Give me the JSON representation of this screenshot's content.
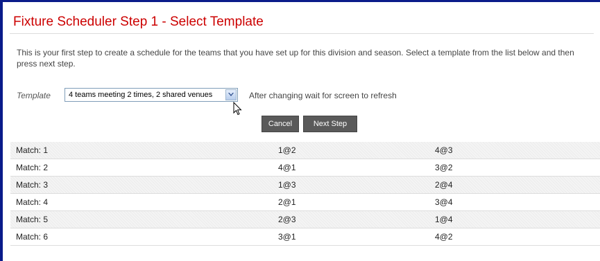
{
  "page": {
    "title": "Fixture Scheduler Step 1 - Select Template",
    "intro": "This is your first step to create a schedule for the teams that you have set up for this division and season. Select a template from the list below and then press next step."
  },
  "template": {
    "label": "Template",
    "selected": "4 teams meeting 2 times, 2 shared venues",
    "note": "After changing wait for screen to refresh"
  },
  "buttons": {
    "cancel": "Cancel",
    "next": "Next Step"
  },
  "matches": [
    {
      "label": "Match: 1",
      "a": "1@2",
      "b": "4@3"
    },
    {
      "label": "Match: 2",
      "a": "4@1",
      "b": "3@2"
    },
    {
      "label": "Match: 3",
      "a": "1@3",
      "b": "2@4"
    },
    {
      "label": "Match: 4",
      "a": "2@1",
      "b": "3@4"
    },
    {
      "label": "Match: 5",
      "a": "2@3",
      "b": "1@4"
    },
    {
      "label": "Match: 6",
      "a": "3@1",
      "b": "4@2"
    }
  ],
  "colors": {
    "title": "#cc0000",
    "frame": "#0a1b8a",
    "button": "#5a5a5a"
  },
  "icons": {
    "dropdown": "chevron-down-icon",
    "cursor": "mouse-pointer-icon"
  }
}
